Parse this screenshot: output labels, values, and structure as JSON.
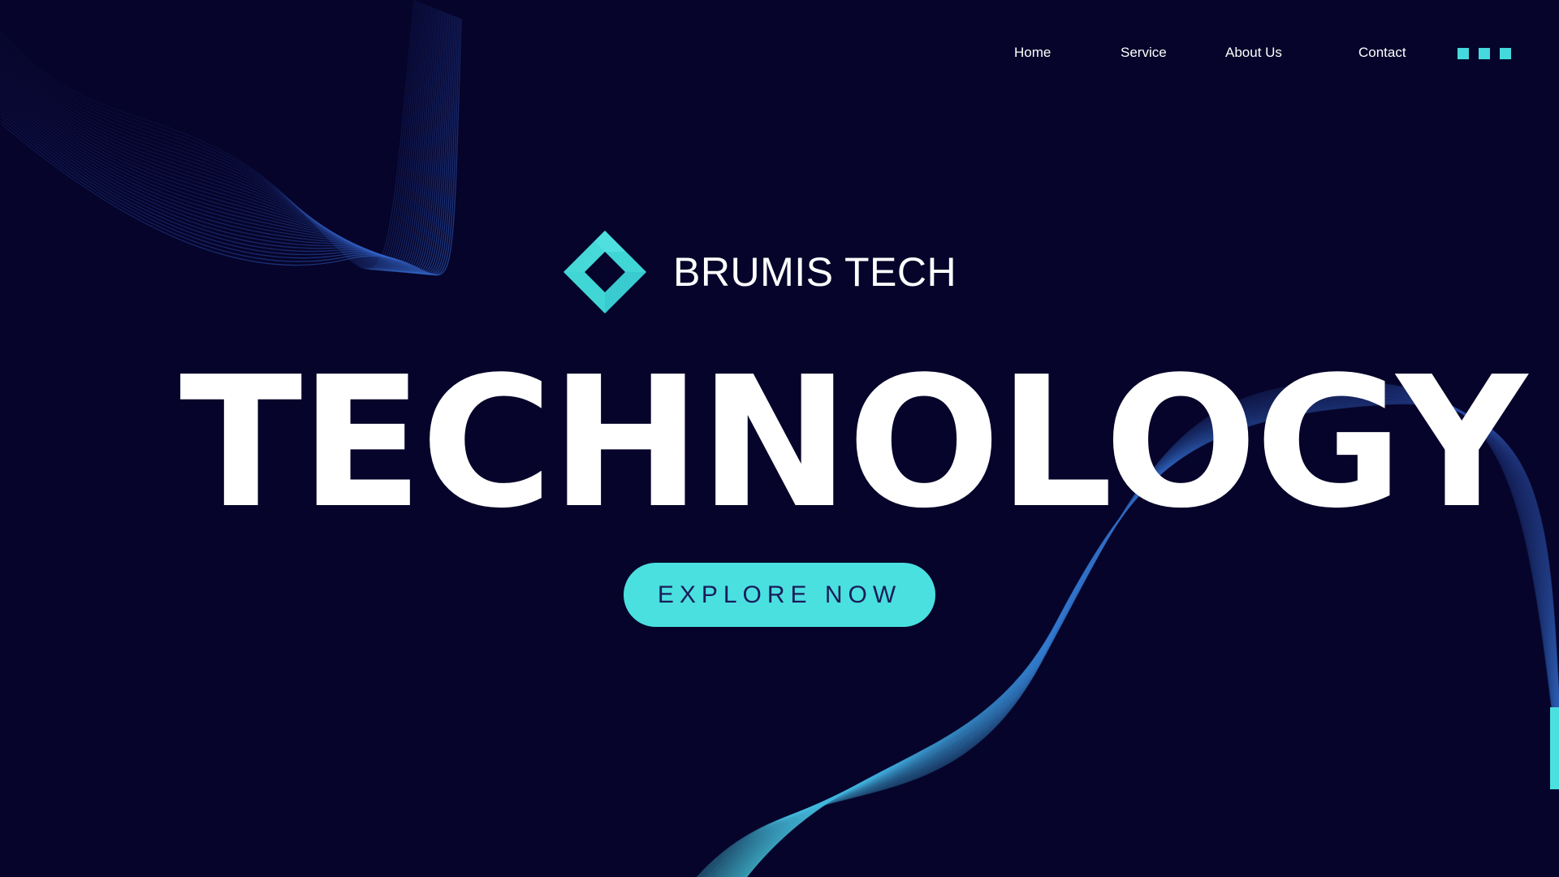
{
  "nav": {
    "home": "Home",
    "service": "Service",
    "about": "About Us",
    "contact": "Contact",
    "menu_icon": "grid-menu-icon"
  },
  "brand": {
    "name": "BRUMIS TECH",
    "logo_icon": "diamond-logo-icon"
  },
  "hero": {
    "title": "TECHNOLOGY",
    "cta_label": "EXPLORE NOW"
  },
  "colors": {
    "background": "#06042a",
    "accent": "#4ae0df",
    "line_blue": "#2a4fb2",
    "line_cyan": "#4fc9e0",
    "text": "#ffffff",
    "button_text": "#1a1c5a"
  }
}
